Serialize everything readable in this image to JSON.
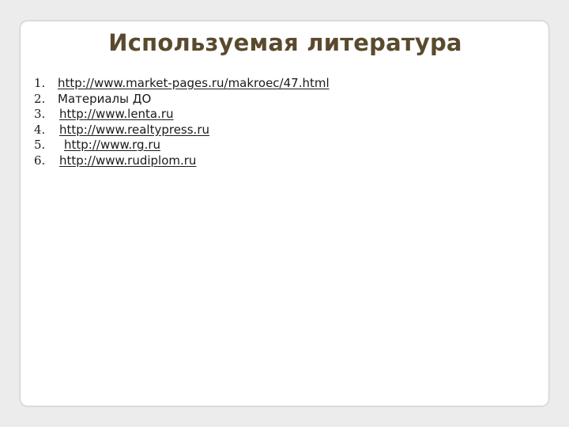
{
  "slide": {
    "title": "Используемая литература",
    "references": [
      {
        "number": "1.",
        "text": "http://www.market-pages.ru/makroec/47.html",
        "is_link": true
      },
      {
        "number": "2.",
        "text": "Материалы ДО",
        "is_link": false
      },
      {
        "number": "3.",
        "text": "http://www.lenta.ru",
        "is_link": true
      },
      {
        "number": "4.",
        "text": "http://www.realtypress.ru",
        "is_link": true
      },
      {
        "number": "5.",
        "text": "http://www.rg.ru",
        "is_link": true
      },
      {
        "number": "6.",
        "text": "http://www.rudiplom.ru",
        "is_link": true
      }
    ],
    "colors": {
      "title": "#5a4a2d",
      "text": "#1a1a1a",
      "background": "#ececec",
      "slide": "#ffffff"
    }
  }
}
